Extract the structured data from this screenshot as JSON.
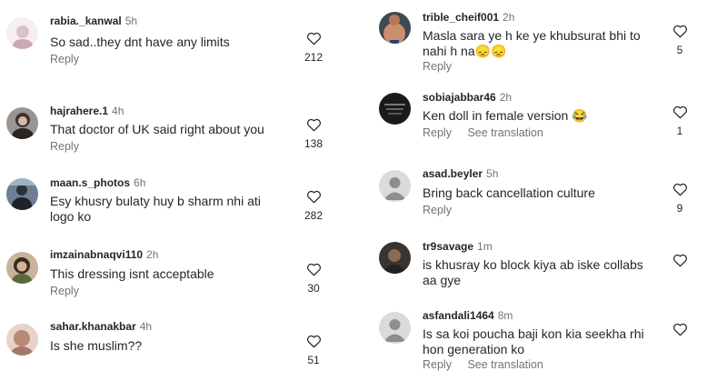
{
  "left_comments": [
    {
      "username": "rabia._kanwal",
      "time": "5h",
      "text": "So sad..they dnt have any limits",
      "actions": [
        "Reply"
      ],
      "likes": "212"
    },
    {
      "username": "hajrahere.1",
      "time": "4h",
      "text": "That doctor of UK said right about you",
      "actions": [
        "Reply"
      ],
      "likes": "138"
    },
    {
      "username": "maan.s_photos",
      "time": "6h",
      "text": "Esy khusry bulaty huy b sharm nhi ati logo ko",
      "actions": [],
      "likes": "282"
    },
    {
      "username": "imzainabnaqvi110",
      "time": "2h",
      "text": "This dressing isnt acceptable",
      "actions": [
        "Reply"
      ],
      "likes": "30"
    },
    {
      "username": "sahar.khanakbar",
      "time": "4h",
      "text": "Is she muslim??",
      "actions": [],
      "likes": "51"
    }
  ],
  "right_comments": [
    {
      "username": "trible_cheif001",
      "time": "2h",
      "text": "Masla sara ye h ke ye khubsurat bhi to nahi h na😞😞",
      "actions": [
        "Reply"
      ],
      "likes": "5"
    },
    {
      "username": "sobiajabbar46",
      "time": "2h",
      "text": "Ken doll in female version 😂",
      "actions": [
        "Reply",
        "See translation"
      ],
      "likes": "1"
    },
    {
      "username": "asad.beyler",
      "time": "5h",
      "text": "Bring back cancellation culture",
      "actions": [
        "Reply"
      ],
      "likes": "9"
    },
    {
      "username": "tr9savage",
      "time": "1m",
      "text": "is khusray ko block kiya ab iske collabs aa gye",
      "actions": [],
      "likes": ""
    },
    {
      "username": "asfandali1464",
      "time": "8m",
      "text": "Is sa koi poucha baji kon kia seekha rhi hon generation ko",
      "actions": [
        "Reply",
        "See translation"
      ],
      "likes": ""
    }
  ],
  "icons": {
    "like": "heart-outline-icon",
    "avatar_default": "default-avatar-icon"
  },
  "colors": {
    "text": "#262626",
    "secondary": "#737373",
    "background": "#ffffff"
  }
}
